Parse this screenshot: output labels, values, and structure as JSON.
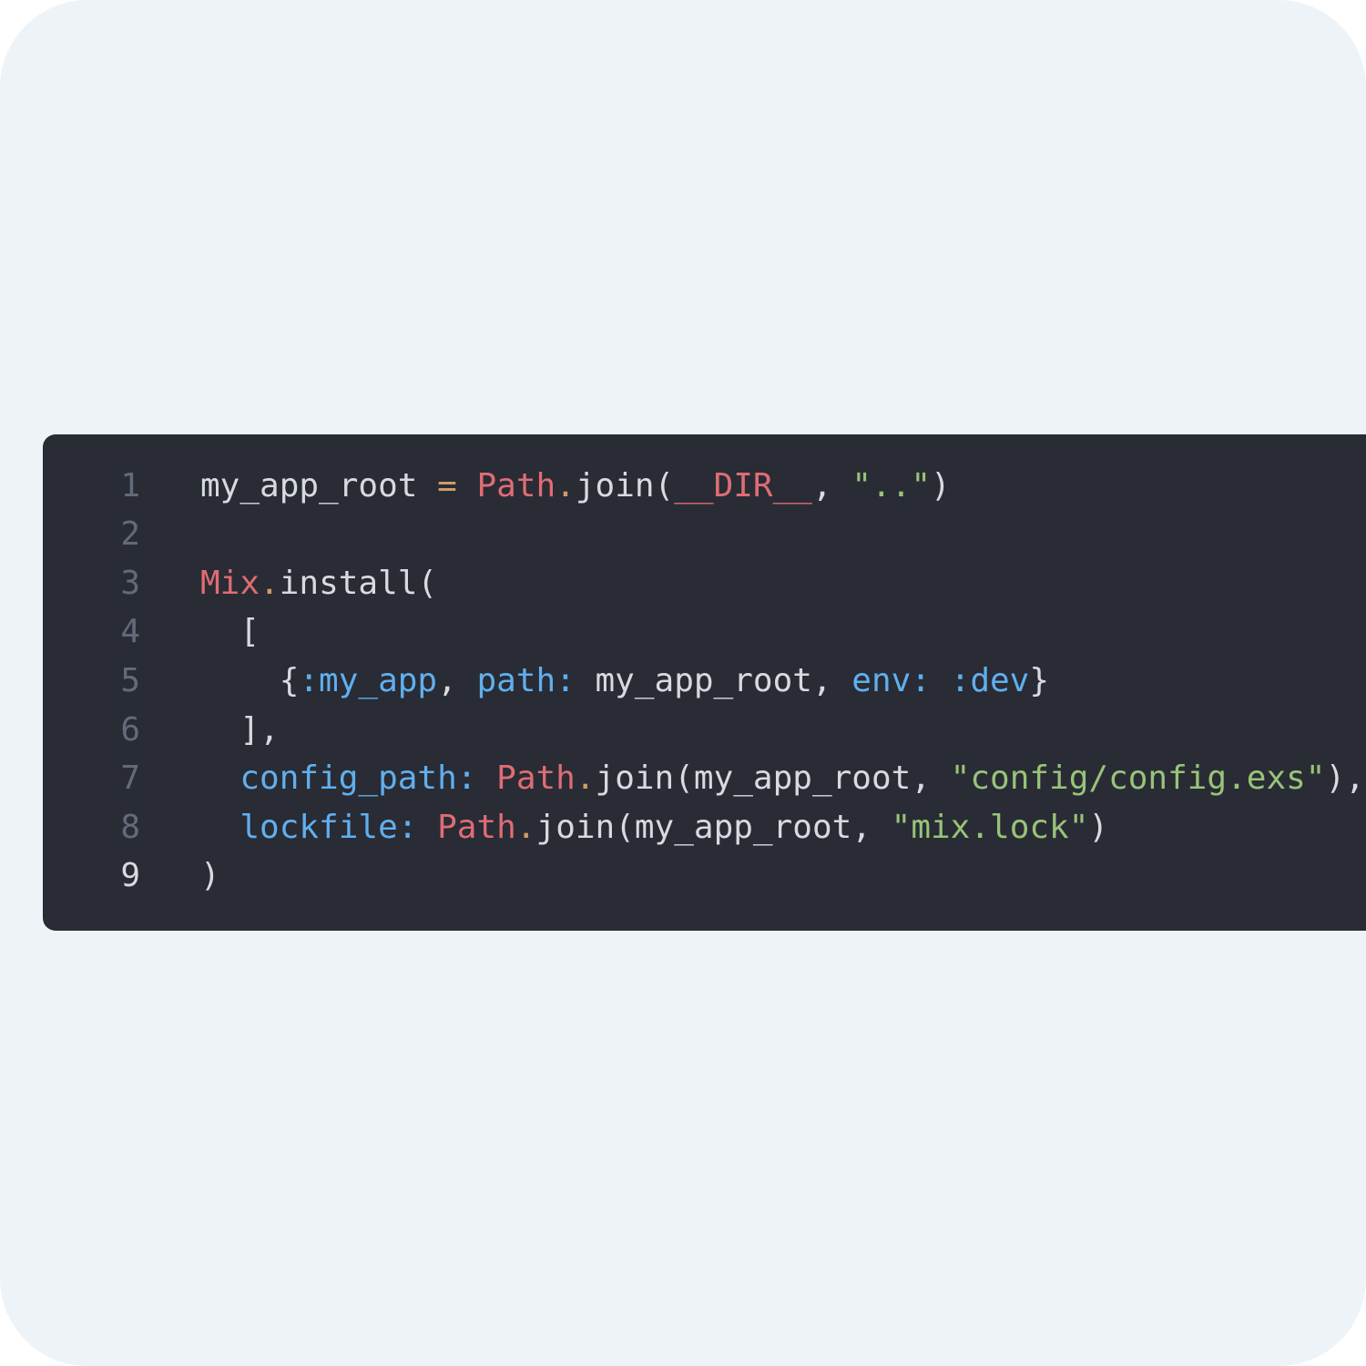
{
  "editor": {
    "current_line": 9,
    "lines": [
      {
        "number": "1",
        "tokens": [
          {
            "t": "my_app_root ",
            "k": "plain"
          },
          {
            "t": "=",
            "k": "op"
          },
          {
            "t": " ",
            "k": "plain"
          },
          {
            "t": "Path",
            "k": "module"
          },
          {
            "t": ".",
            "k": "op"
          },
          {
            "t": "join(",
            "k": "plain"
          },
          {
            "t": "__DIR__",
            "k": "special"
          },
          {
            "t": ", ",
            "k": "plain"
          },
          {
            "t": "\"..\"",
            "k": "string"
          },
          {
            "t": ")",
            "k": "plain"
          }
        ]
      },
      {
        "number": "2",
        "tokens": []
      },
      {
        "number": "3",
        "tokens": [
          {
            "t": "Mix",
            "k": "module"
          },
          {
            "t": ".",
            "k": "op"
          },
          {
            "t": "install(",
            "k": "plain"
          }
        ]
      },
      {
        "number": "4",
        "tokens": [
          {
            "t": "  [",
            "k": "plain"
          }
        ]
      },
      {
        "number": "5",
        "tokens": [
          {
            "t": "    {",
            "k": "plain"
          },
          {
            "t": ":my_app",
            "k": "atom"
          },
          {
            "t": ", ",
            "k": "plain"
          },
          {
            "t": "path:",
            "k": "key"
          },
          {
            "t": " my_app_root, ",
            "k": "plain"
          },
          {
            "t": "env:",
            "k": "key"
          },
          {
            "t": " ",
            "k": "plain"
          },
          {
            "t": ":dev",
            "k": "atom"
          },
          {
            "t": "}",
            "k": "plain"
          }
        ]
      },
      {
        "number": "6",
        "tokens": [
          {
            "t": "  ],",
            "k": "plain"
          }
        ]
      },
      {
        "number": "7",
        "tokens": [
          {
            "t": "  ",
            "k": "plain"
          },
          {
            "t": "config_path:",
            "k": "key"
          },
          {
            "t": " ",
            "k": "plain"
          },
          {
            "t": "Path",
            "k": "module"
          },
          {
            "t": ".",
            "k": "op"
          },
          {
            "t": "join(my_app_root, ",
            "k": "plain"
          },
          {
            "t": "\"config/config.exs\"",
            "k": "string"
          },
          {
            "t": "),",
            "k": "plain"
          }
        ]
      },
      {
        "number": "8",
        "tokens": [
          {
            "t": "  ",
            "k": "plain"
          },
          {
            "t": "lockfile:",
            "k": "key"
          },
          {
            "t": " ",
            "k": "plain"
          },
          {
            "t": "Path",
            "k": "module"
          },
          {
            "t": ".",
            "k": "op"
          },
          {
            "t": "join(my_app_root, ",
            "k": "plain"
          },
          {
            "t": "\"mix.lock\"",
            "k": "string"
          },
          {
            "t": ")",
            "k": "plain"
          }
        ]
      },
      {
        "number": "9",
        "tokens": [
          {
            "t": ")",
            "k": "plain"
          }
        ]
      }
    ]
  },
  "colors": {
    "page_background": "#eef3f8",
    "editor_background": "#292c34",
    "plain": "#d7dae0",
    "module": "#e06c75",
    "operator": "#d19a66",
    "string": "#98c379",
    "atom_and_key": "#61afef",
    "line_number": "#636a7a"
  }
}
